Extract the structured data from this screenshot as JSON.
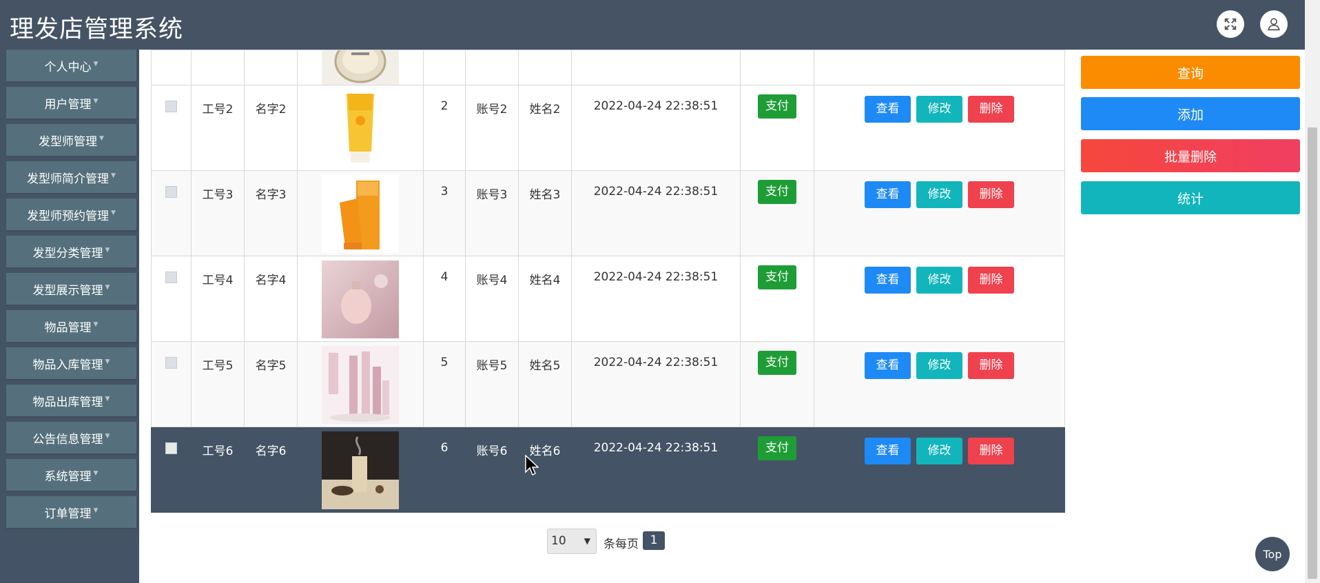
{
  "header": {
    "title": "理发店管理系统"
  },
  "sidebar": {
    "items": [
      {
        "label": "个人中心"
      },
      {
        "label": "用户管理"
      },
      {
        "label": "发型师管理"
      },
      {
        "label": "发型师简介管理"
      },
      {
        "label": "发型师预约管理"
      },
      {
        "label": "发型分类管理"
      },
      {
        "label": "发型展示管理"
      },
      {
        "label": "物品管理"
      },
      {
        "label": "物品入库管理"
      },
      {
        "label": "物品出库管理"
      },
      {
        "label": "公告信息管理"
      },
      {
        "label": "系统管理"
      },
      {
        "label": "订单管理"
      }
    ]
  },
  "actions": {
    "query": "查询",
    "add": "添加",
    "batch_delete": "批量删除",
    "stats": "统计"
  },
  "table": {
    "pay_label": "支付",
    "view_label": "查看",
    "edit_label": "修改",
    "delete_label": "删除",
    "rows": [
      {
        "emp_no": "工号2",
        "name": "名字2",
        "num": "2",
        "account": "账号2",
        "real_name": "姓名2",
        "time": "2022-04-24 22:38:51",
        "image": "sunscreen-yellow-tube"
      },
      {
        "emp_no": "工号3",
        "name": "名字3",
        "num": "3",
        "account": "账号3",
        "real_name": "姓名3",
        "time": "2022-04-24 22:38:51",
        "image": "sunscreen-orange-box"
      },
      {
        "emp_no": "工号4",
        "name": "名字4",
        "num": "4",
        "account": "账号4",
        "real_name": "姓名4",
        "time": "2022-04-24 22:38:51",
        "image": "perfume-bottle-pink"
      },
      {
        "emp_no": "工号5",
        "name": "名字5",
        "num": "5",
        "account": "账号5",
        "real_name": "姓名5",
        "time": "2022-04-24 22:38:51",
        "image": "cosmetics-set-pink"
      },
      {
        "emp_no": "工号6",
        "name": "名字6",
        "num": "6",
        "account": "账号6",
        "real_name": "姓名6",
        "time": "2022-04-24 22:38:51",
        "image": "incense-burner"
      }
    ]
  },
  "pagination": {
    "page_size": "10",
    "per_page_label": "条每页",
    "current_page": "1"
  },
  "top_button": "Top",
  "colors": {
    "header": "#455365",
    "sidebar_item": "#55707c",
    "query": "#fb8c00",
    "add": "#1e8af5",
    "batch_delete": "#f0414e",
    "stats": "#12b5bc",
    "pay": "#1e9d36"
  }
}
